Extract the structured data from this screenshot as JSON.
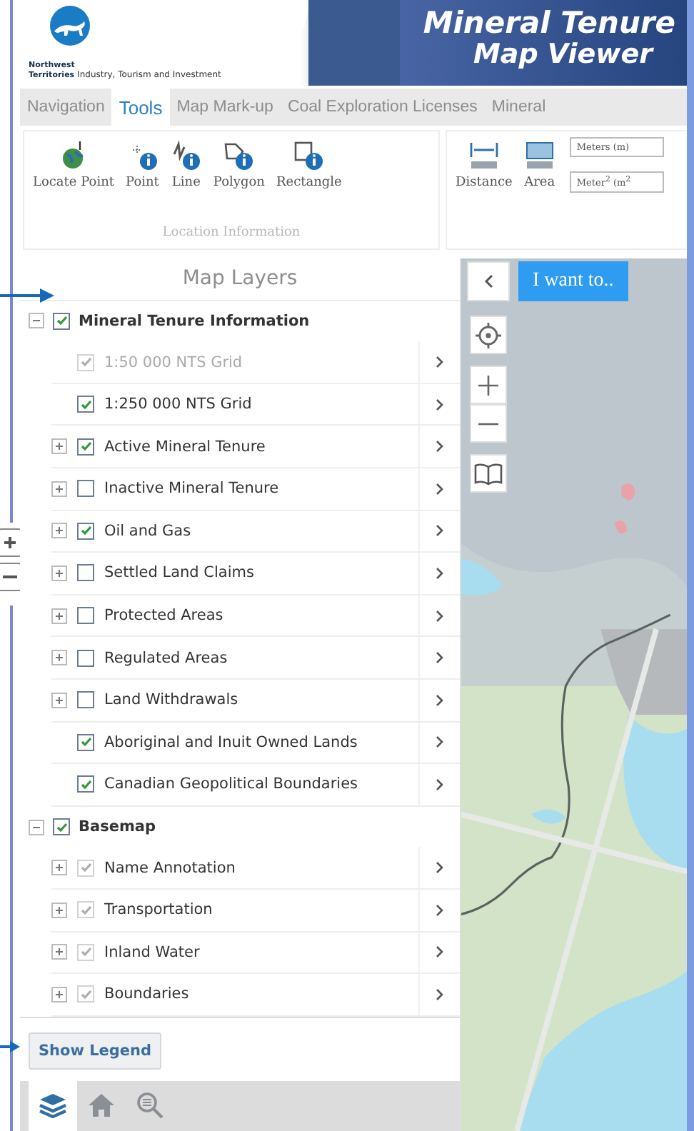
{
  "header": {
    "org_line_1": "Northwest",
    "org_line_2": "Territories",
    "department": "Industry, Tourism and Investment",
    "title_line_1": "Mineral Tenure",
    "title_line_2": "Map Viewer"
  },
  "tabs": [
    {
      "label": "Navigation",
      "selected": false
    },
    {
      "label": "Tools",
      "selected": true
    },
    {
      "label": "Map Mark-up",
      "selected": false
    },
    {
      "label": "Coal Exploration Licenses",
      "selected": false
    },
    {
      "label": "Mineral",
      "selected": false
    }
  ],
  "ribbon": {
    "location_group": {
      "label": "Location Information",
      "tools": [
        {
          "kind": "locate",
          "label": "Locate Point"
        },
        {
          "kind": "point",
          "label": "Point"
        },
        {
          "kind": "line",
          "label": "Line"
        },
        {
          "kind": "polygon",
          "label": "Polygon"
        },
        {
          "kind": "rectangle",
          "label": "Rectangle"
        }
      ]
    },
    "measure_group": {
      "tools": [
        {
          "kind": "distance",
          "label": "Distance"
        },
        {
          "kind": "area",
          "label": "Area"
        }
      ],
      "unit_fields": [
        {
          "value": "Meters (m)"
        },
        {
          "value": "Meter$^{2}$ (m$^{2}$"
        }
      ]
    }
  },
  "layers_panel": {
    "title": "Map Layers",
    "groups": [
      {
        "label": "Mineral Tenure Information",
        "expanded": true,
        "checked": true,
        "layers": [
          {
            "kind": "layer",
            "label": "1:50 000 NTS Grid",
            "checked": true,
            "dimmed": true,
            "disabled": true
          },
          {
            "kind": "layer",
            "label": "1:250 000 NTS Grid",
            "checked": true,
            "dimmed": false,
            "disabled": false
          },
          {
            "kind": "sublist",
            "label": "Active Mineral Tenure",
            "checked": true,
            "dimmed": false,
            "disabled": false
          },
          {
            "kind": "sublist",
            "label": "Inactive Mineral Tenure",
            "checked": false,
            "dimmed": false,
            "disabled": false
          },
          {
            "kind": "sublist",
            "label": "Oil and Gas",
            "checked": true,
            "dimmed": false,
            "disabled": false
          },
          {
            "kind": "sublist",
            "label": "Settled Land Claims",
            "checked": false,
            "dimmed": false,
            "disabled": false
          },
          {
            "kind": "sublist",
            "label": "Protected Areas",
            "checked": false,
            "dimmed": false,
            "disabled": false
          },
          {
            "kind": "sublist",
            "label": "Regulated Areas",
            "checked": false,
            "dimmed": false,
            "disabled": false
          },
          {
            "kind": "sublist",
            "label": "Land Withdrawals",
            "checked": false,
            "dimmed": false,
            "disabled": false
          },
          {
            "kind": "layer",
            "label": "Aboriginal and Inuit Owned Lands",
            "checked": true,
            "dimmed": false,
            "disabled": false
          },
          {
            "kind": "layer",
            "label": "Canadian Geopolitical Boundaries",
            "checked": true,
            "dimmed": false,
            "disabled": false
          }
        ]
      },
      {
        "label": "Basemap",
        "expanded": true,
        "checked": true,
        "layers": [
          {
            "kind": "sublist",
            "label": "Name Annotation",
            "checked": true,
            "dimmed": true,
            "disabled": false
          },
          {
            "kind": "sublist",
            "label": "Transportation",
            "checked": true,
            "dimmed": true,
            "disabled": false
          },
          {
            "kind": "sublist",
            "label": "Inland Water",
            "checked": true,
            "dimmed": true,
            "disabled": false
          },
          {
            "kind": "sublist",
            "label": "Boundaries",
            "checked": true,
            "dimmed": true,
            "disabled": false
          }
        ]
      }
    ],
    "legend_button": "Show Legend",
    "bottom_tabs": [
      {
        "kind": "layers",
        "selected": true
      },
      {
        "kind": "home",
        "selected": false
      },
      {
        "kind": "search",
        "selected": false
      }
    ]
  },
  "map": {
    "action_button": "I want to.."
  }
}
